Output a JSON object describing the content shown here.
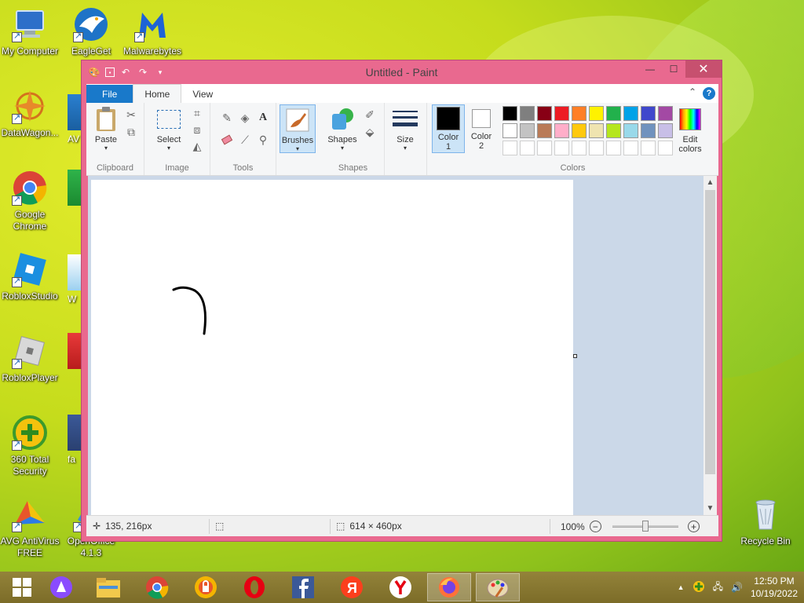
{
  "desktop": {
    "icons": [
      {
        "label": "My Computer",
        "icon": "computer-icon"
      },
      {
        "label": "EagleGet",
        "icon": "eagleget-icon"
      },
      {
        "label": "Malwarebytes",
        "icon": "malwarebytes-icon"
      },
      {
        "label": "DataWagon...",
        "icon": "datawagon-icon"
      },
      {
        "label": "Google Chrome",
        "icon": "chrome-icon"
      },
      {
        "label": "RobloxStudio",
        "icon": "roblox-studio-icon"
      },
      {
        "label": "RobloxPlayer",
        "icon": "roblox-player-icon"
      },
      {
        "label": "360 Total Security",
        "icon": "360-security-icon"
      },
      {
        "label": "AVG AntiVirus FREE",
        "icon": "avg-icon"
      },
      {
        "label": "OpenOffice 4.1.3",
        "icon": "openoffice-icon"
      },
      {
        "label": "Recycle Bin",
        "icon": "recycle-bin-icon"
      }
    ],
    "partial_labels": [
      "AV",
      "B",
      "W",
      "B",
      "fa"
    ]
  },
  "paint": {
    "title": "Untitled - Paint",
    "tabs": {
      "file": "File",
      "home": "Home",
      "view": "View"
    },
    "clipboard": {
      "paste": "Paste",
      "group": "Clipboard"
    },
    "image": {
      "select": "Select",
      "group": "Image"
    },
    "tools": {
      "group": "Tools"
    },
    "brushes": {
      "label": "Brushes"
    },
    "shapes": {
      "label": "Shapes",
      "group": "Shapes"
    },
    "size": {
      "label": "Size"
    },
    "colors": {
      "color1": "Color\n1",
      "color1_line1": "Color",
      "color1_line2": "1",
      "color2_line1": "Color",
      "color2_line2": "2",
      "edit_line1": "Edit",
      "edit_line2": "colors",
      "group": "Colors",
      "color1_value": "#000000",
      "color2_value": "#ffffff",
      "palette_row1": [
        "#000000",
        "#7f7f7f",
        "#880015",
        "#ed1c24",
        "#ff7f27",
        "#fff200",
        "#22b14c",
        "#00a2e8",
        "#3f48cc",
        "#a349a4"
      ],
      "palette_row2": [
        "#ffffff",
        "#c3c3c3",
        "#b97a57",
        "#ffaec9",
        "#ffc90e",
        "#efe4b0",
        "#b5e61d",
        "#99d9ea",
        "#7092be",
        "#c8bfe7"
      ]
    },
    "status": {
      "cursor_pos": "135, 216px",
      "canvas_size": "614 × 460px",
      "zoom": "100%",
      "zoom_fraction": 0.5
    },
    "accent": "#e9698f"
  },
  "taskbar": {
    "time": "12:50 PM",
    "date": "10/19/2022",
    "pinned": [
      "start",
      "cortana",
      "file-explorer",
      "chrome",
      "browser",
      "opera",
      "facebook",
      "yandex",
      "yandex-browser",
      "firefox",
      "paint"
    ]
  }
}
